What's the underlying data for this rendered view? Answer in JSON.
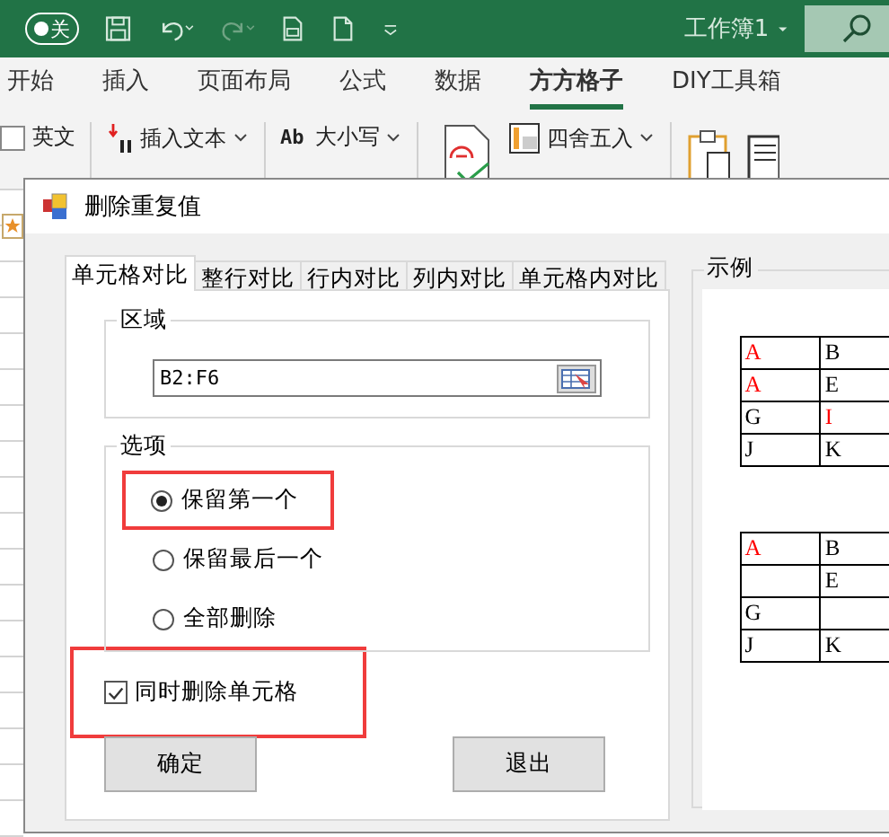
{
  "app": {
    "autosave_toggle": {
      "label": "关",
      "on": false
    },
    "document_title": "工作簿1"
  },
  "ribbon_tabs": [
    {
      "label": "开始",
      "selected": false
    },
    {
      "label": "插入",
      "selected": false
    },
    {
      "label": "页面布局",
      "selected": false
    },
    {
      "label": "公式",
      "selected": false
    },
    {
      "label": "数据",
      "selected": false
    },
    {
      "label": "方方格子",
      "selected": true
    },
    {
      "label": "DIY工具箱",
      "selected": false
    }
  ],
  "ribbon_commands": [
    {
      "kind": "checkbox",
      "label": "英文",
      "checked": false
    },
    {
      "kind": "button",
      "label": "插入文本"
    },
    {
      "kind": "button",
      "label": "大小写",
      "icon_text": "Ab"
    },
    {
      "kind": "large"
    },
    {
      "kind": "button",
      "label": "四舍五入"
    }
  ],
  "dialog": {
    "title": "删除重复值",
    "tabs": [
      {
        "label": "单元格对比",
        "selected": true
      },
      {
        "label": "整行对比",
        "selected": false
      },
      {
        "label": "行内对比",
        "selected": false
      },
      {
        "label": "列内对比",
        "selected": false
      },
      {
        "label": "单元格内对比",
        "selected": false
      }
    ],
    "range_group": {
      "title": "区域",
      "value": "B2:F6"
    },
    "options_group": {
      "title": "选项",
      "options": [
        {
          "label": "保留第一个",
          "selected": true,
          "highlighted": true
        },
        {
          "label": "保留最后一个",
          "selected": false,
          "highlighted": false
        },
        {
          "label": "全部删除",
          "selected": false,
          "highlighted": false
        }
      ]
    },
    "delete_cells": {
      "label": "同时删除单元格",
      "checked": true,
      "highlighted": true
    },
    "buttons": [
      "确定",
      "退出"
    ],
    "example": {
      "title": "示例",
      "tables": [
        {
          "rows": [
            [
              {
                "text": "A",
                "color": "#ff0000"
              },
              {
                "text": "B",
                "color": "#000000"
              }
            ],
            [
              {
                "text": "A",
                "color": "#ff0000"
              },
              {
                "text": "E",
                "color": "#000000"
              }
            ],
            [
              {
                "text": "G",
                "color": "#000000"
              },
              {
                "text": "I",
                "color": "#ff0000"
              }
            ],
            [
              {
                "text": "J",
                "color": "#000000"
              },
              {
                "text": "K",
                "color": "#000000"
              }
            ]
          ]
        },
        {
          "rows": [
            [
              {
                "text": "A",
                "color": "#ff0000"
              },
              {
                "text": "B",
                "color": "#000000"
              }
            ],
            [
              null,
              {
                "text": "E",
                "color": "#000000"
              }
            ],
            [
              {
                "text": "G",
                "color": "#000000"
              },
              null
            ],
            [
              {
                "text": "J",
                "color": "#000000"
              },
              {
                "text": "K",
                "color": "#000000"
              }
            ]
          ]
        }
      ]
    }
  }
}
